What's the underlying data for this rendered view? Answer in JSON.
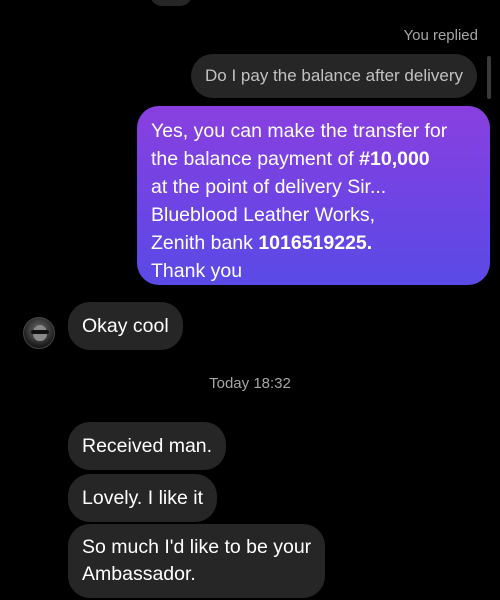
{
  "conversation": {
    "reply_label": "You replied",
    "quoted_message": "Do I pay the balance after delivery",
    "sent_message": {
      "line1": "Yes, you can make the transfer for",
      "line2": "the balance payment of",
      "amount": "#10,000",
      "line3": "at the point of delivery Sir...",
      "line4": "Blueblood Leather Works,",
      "line5_prefix": "Zenith bank",
      "account_number": "1016519225.",
      "line6": "Thank you"
    },
    "received_reply": "Okay cool",
    "timestamp": "Today 18:32",
    "received_messages": {
      "msg1": "Received man.",
      "msg2": "Lovely. I like it",
      "msg3_line1": "So much I'd like to be your",
      "msg3_line2": "Ambassador."
    }
  },
  "colors": {
    "background": "#000000",
    "received_bubble": "#262626",
    "sent_gradient_top": "#8a3fe0",
    "sent_gradient_bottom": "#5a4ae6",
    "muted_text": "#a6a6a6"
  }
}
